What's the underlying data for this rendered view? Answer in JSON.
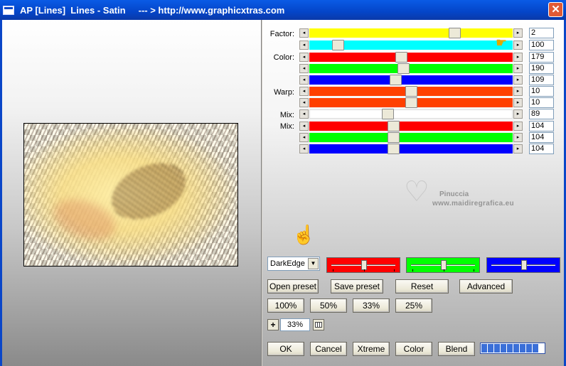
{
  "window": {
    "title": "AP [Lines]  Lines - Satin     --- > http://www.graphicxtras.com",
    "close_symbol": "✕"
  },
  "params": {
    "factor_label": "Factor:",
    "color_label": "Color:",
    "warp_label": "Warp:",
    "mix1_label": "Mix:",
    "mix2_label": "Mix:",
    "sliders": [
      {
        "value": "2",
        "color": "#ffff00",
        "fraction": 0.73
      },
      {
        "value": "100",
        "color": "#00ffff",
        "fraction": 0.12
      },
      {
        "value": "179",
        "color": "#ff0000",
        "fraction": 0.45
      },
      {
        "value": "190",
        "color": "#00ff00",
        "fraction": 0.46
      },
      {
        "value": "109",
        "color": "#0000ff",
        "fraction": 0.42
      },
      {
        "value": "10",
        "color": "#ff4000",
        "fraction": 0.5
      },
      {
        "value": "10",
        "color": "#ff4000",
        "fraction": 0.5
      },
      {
        "value": "89",
        "color": "#ffffff",
        "fraction": 0.38
      },
      {
        "value": "104",
        "color": "#ff0000",
        "fraction": 0.41
      },
      {
        "value": "104",
        "color": "#00ff00",
        "fraction": 0.41
      },
      {
        "value": "104",
        "color": "#0000ff",
        "fraction": 0.41
      }
    ]
  },
  "watermark": {
    "line1": "Pinuccia",
    "line2": "www.maidiregrafica.eu"
  },
  "edge_select": {
    "value": "DarkEdge"
  },
  "color_sliders": [
    {
      "name": "red",
      "color": "#ff0000",
      "fraction": 0.5
    },
    {
      "name": "green",
      "color": "#00ff00",
      "fraction": 0.5
    },
    {
      "name": "blue",
      "color": "#0000ff",
      "fraction": 0.5
    }
  ],
  "buttons": {
    "open_preset": "Open preset",
    "save_preset": "Save preset",
    "reset": "Reset",
    "advanced": "Advanced",
    "z100": "100%",
    "z50": "50%",
    "z33": "33%",
    "z25": "25%",
    "ok": "OK",
    "cancel": "Cancel",
    "xtreme": "Xtreme",
    "color": "Color",
    "blend": "Blend"
  },
  "zoom": {
    "plus_label": "+",
    "value": "33%"
  },
  "progress": {
    "segments": 9,
    "fraction": 1.0
  }
}
